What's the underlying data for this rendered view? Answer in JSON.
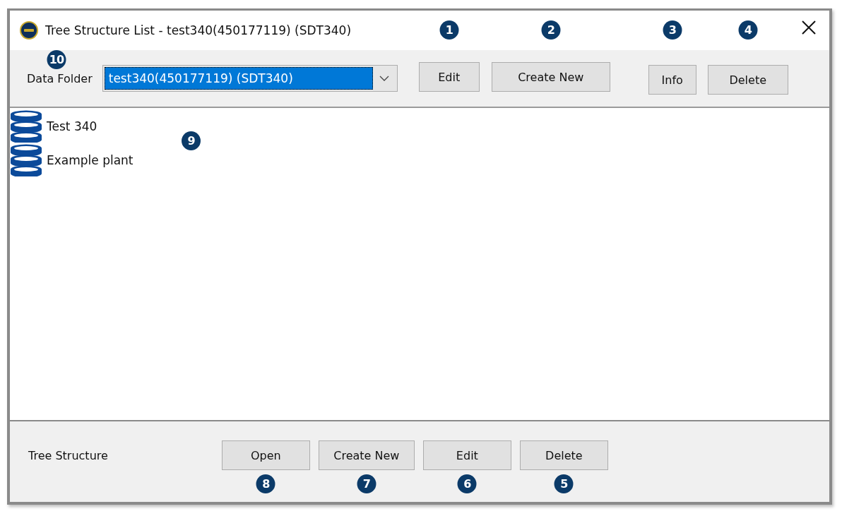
{
  "window": {
    "title": "Tree Structure List - test340(450177119) (SDT340)"
  },
  "toolbar": {
    "label": "Data Folder",
    "label_callout": "10",
    "folder_select": {
      "value": "test340(450177119) (SDT340)"
    },
    "buttons": [
      {
        "label": "Edit",
        "callout": "1"
      },
      {
        "label": "Create New",
        "callout": "2"
      },
      {
        "label": "Info",
        "callout": "3"
      },
      {
        "label": "Delete",
        "callout": "4"
      }
    ]
  },
  "list": {
    "callout": "9",
    "items": [
      {
        "label": "Test 340"
      },
      {
        "label": "Example plant"
      }
    ]
  },
  "footer": {
    "label": "Tree Structure",
    "buttons": [
      {
        "label": "Open",
        "callout": "8"
      },
      {
        "label": "Create New",
        "callout": "7"
      },
      {
        "label": "Edit",
        "callout": "6"
      },
      {
        "label": "Delete",
        "callout": "5"
      }
    ]
  }
}
